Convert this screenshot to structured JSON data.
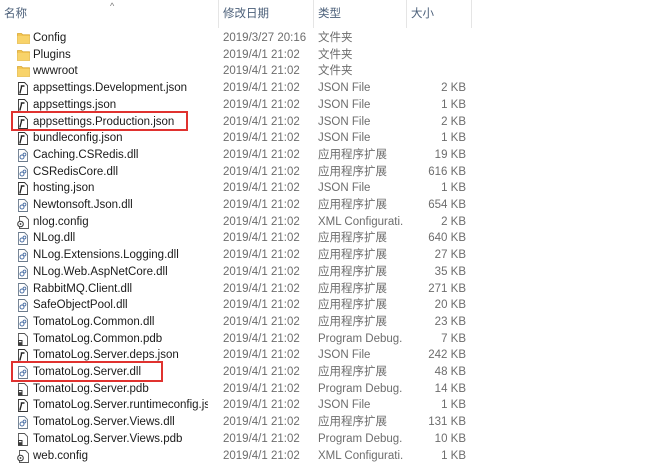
{
  "columns": {
    "name": "名称",
    "date": "修改日期",
    "type": "类型",
    "size": "大小"
  },
  "sort_indicator": "^",
  "files": [
    {
      "name": "Config",
      "date": "2019/3/27 20:16",
      "type": "文件夹",
      "size": "",
      "icon": "folder-icon"
    },
    {
      "name": "Plugins",
      "date": "2019/4/1 21:02",
      "type": "文件夹",
      "size": "",
      "icon": "folder-icon"
    },
    {
      "name": "wwwroot",
      "date": "2019/4/1 21:02",
      "type": "文件夹",
      "size": "",
      "icon": "folder-icon"
    },
    {
      "name": "appsettings.Development.json",
      "date": "2019/4/1 21:02",
      "type": "JSON File",
      "size": "2 KB",
      "icon": "json-file-icon"
    },
    {
      "name": "appsettings.json",
      "date": "2019/4/1 21:02",
      "type": "JSON File",
      "size": "1 KB",
      "icon": "json-file-icon"
    },
    {
      "name": "appsettings.Production.json",
      "date": "2019/4/1 21:02",
      "type": "JSON File",
      "size": "2 KB",
      "icon": "json-file-icon",
      "highlighted": true
    },
    {
      "name": "bundleconfig.json",
      "date": "2019/4/1 21:02",
      "type": "JSON File",
      "size": "1 KB",
      "icon": "json-file-icon"
    },
    {
      "name": "Caching.CSRedis.dll",
      "date": "2019/4/1 21:02",
      "type": "应用程序扩展",
      "size": "19 KB",
      "icon": "dll-file-icon"
    },
    {
      "name": "CSRedisCore.dll",
      "date": "2019/4/1 21:02",
      "type": "应用程序扩展",
      "size": "616 KB",
      "icon": "dll-file-icon"
    },
    {
      "name": "hosting.json",
      "date": "2019/4/1 21:02",
      "type": "JSON File",
      "size": "1 KB",
      "icon": "json-file-icon"
    },
    {
      "name": "Newtonsoft.Json.dll",
      "date": "2019/4/1 21:02",
      "type": "应用程序扩展",
      "size": "654 KB",
      "icon": "dll-file-icon"
    },
    {
      "name": "nlog.config",
      "date": "2019/4/1 21:02",
      "type": "XML Configurati...",
      "size": "2 KB",
      "icon": "config-file-icon"
    },
    {
      "name": "NLog.dll",
      "date": "2019/4/1 21:02",
      "type": "应用程序扩展",
      "size": "640 KB",
      "icon": "dll-file-icon"
    },
    {
      "name": "NLog.Extensions.Logging.dll",
      "date": "2019/4/1 21:02",
      "type": "应用程序扩展",
      "size": "27 KB",
      "icon": "dll-file-icon"
    },
    {
      "name": "NLog.Web.AspNetCore.dll",
      "date": "2019/4/1 21:02",
      "type": "应用程序扩展",
      "size": "35 KB",
      "icon": "dll-file-icon"
    },
    {
      "name": "RabbitMQ.Client.dll",
      "date": "2019/4/1 21:02",
      "type": "应用程序扩展",
      "size": "271 KB",
      "icon": "dll-file-icon"
    },
    {
      "name": "SafeObjectPool.dll",
      "date": "2019/4/1 21:02",
      "type": "应用程序扩展",
      "size": "20 KB",
      "icon": "dll-file-icon"
    },
    {
      "name": "TomatoLog.Common.dll",
      "date": "2019/4/1 21:02",
      "type": "应用程序扩展",
      "size": "23 KB",
      "icon": "dll-file-icon"
    },
    {
      "name": "TomatoLog.Common.pdb",
      "date": "2019/4/1 21:02",
      "type": "Program Debug...",
      "size": "7 KB",
      "icon": "pdb-file-icon"
    },
    {
      "name": "TomatoLog.Server.deps.json",
      "date": "2019/4/1 21:02",
      "type": "JSON File",
      "size": "242 KB",
      "icon": "json-file-icon"
    },
    {
      "name": "TomatoLog.Server.dll",
      "date": "2019/4/1 21:02",
      "type": "应用程序扩展",
      "size": "48 KB",
      "icon": "dll-file-icon",
      "highlighted": true
    },
    {
      "name": "TomatoLog.Server.pdb",
      "date": "2019/4/1 21:02",
      "type": "Program Debug...",
      "size": "14 KB",
      "icon": "pdb-file-icon"
    },
    {
      "name": "TomatoLog.Server.runtimeconfig.json",
      "date": "2019/4/1 21:02",
      "type": "JSON File",
      "size": "1 KB",
      "icon": "json-file-icon"
    },
    {
      "name": "TomatoLog.Server.Views.dll",
      "date": "2019/4/1 21:02",
      "type": "应用程序扩展",
      "size": "131 KB",
      "icon": "dll-file-icon"
    },
    {
      "name": "TomatoLog.Server.Views.pdb",
      "date": "2019/4/1 21:02",
      "type": "Program Debug...",
      "size": "10 KB",
      "icon": "pdb-file-icon"
    },
    {
      "name": "web.config",
      "date": "2019/4/1 21:02",
      "type": "XML Configurati...",
      "size": "1 KB",
      "icon": "config-file-icon"
    }
  ],
  "colors": {
    "highlight": "#e0322f",
    "header_text": "#4c607a",
    "folder": "#f3c44f"
  }
}
